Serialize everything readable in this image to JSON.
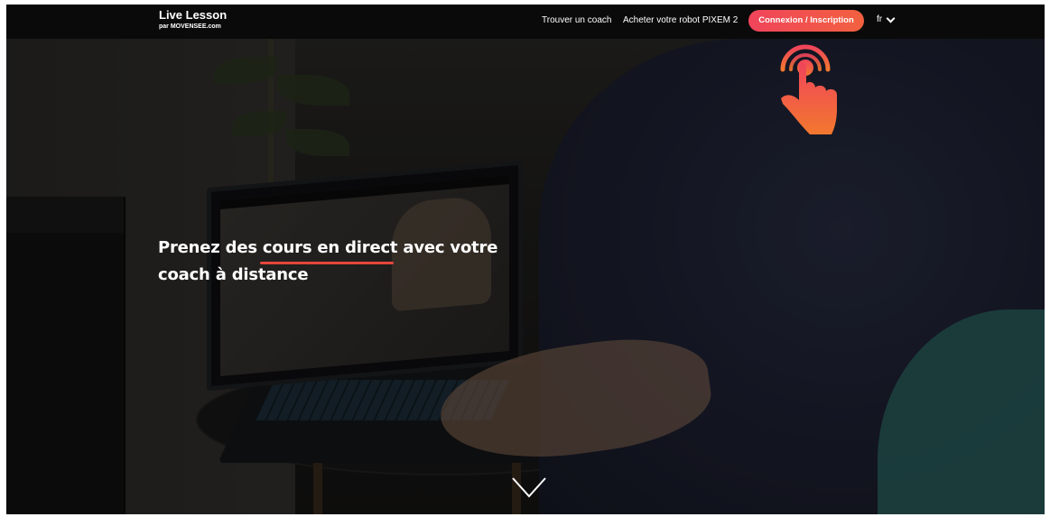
{
  "brand": {
    "title": "Live Lesson",
    "subtitle": "par MOVENSEE.com"
  },
  "nav": {
    "links": [
      "Trouver un coach",
      "Acheter votre robot PIXEM 2"
    ],
    "cta_label": "Connexion / Inscription",
    "language": "fr"
  },
  "hero": {
    "headline_line1": "Prenez des cours en direct avec votre",
    "headline_line2": "coach à distance"
  },
  "icons": {
    "tap": "tap-hand-icon",
    "scroll": "chevron-down-icon",
    "lang": "chevron-down-icon"
  },
  "colors": {
    "accent_start": "#f0445b",
    "accent_end": "#f2613f",
    "underline": "#e5463b",
    "navbar": "#0a0a0a"
  }
}
